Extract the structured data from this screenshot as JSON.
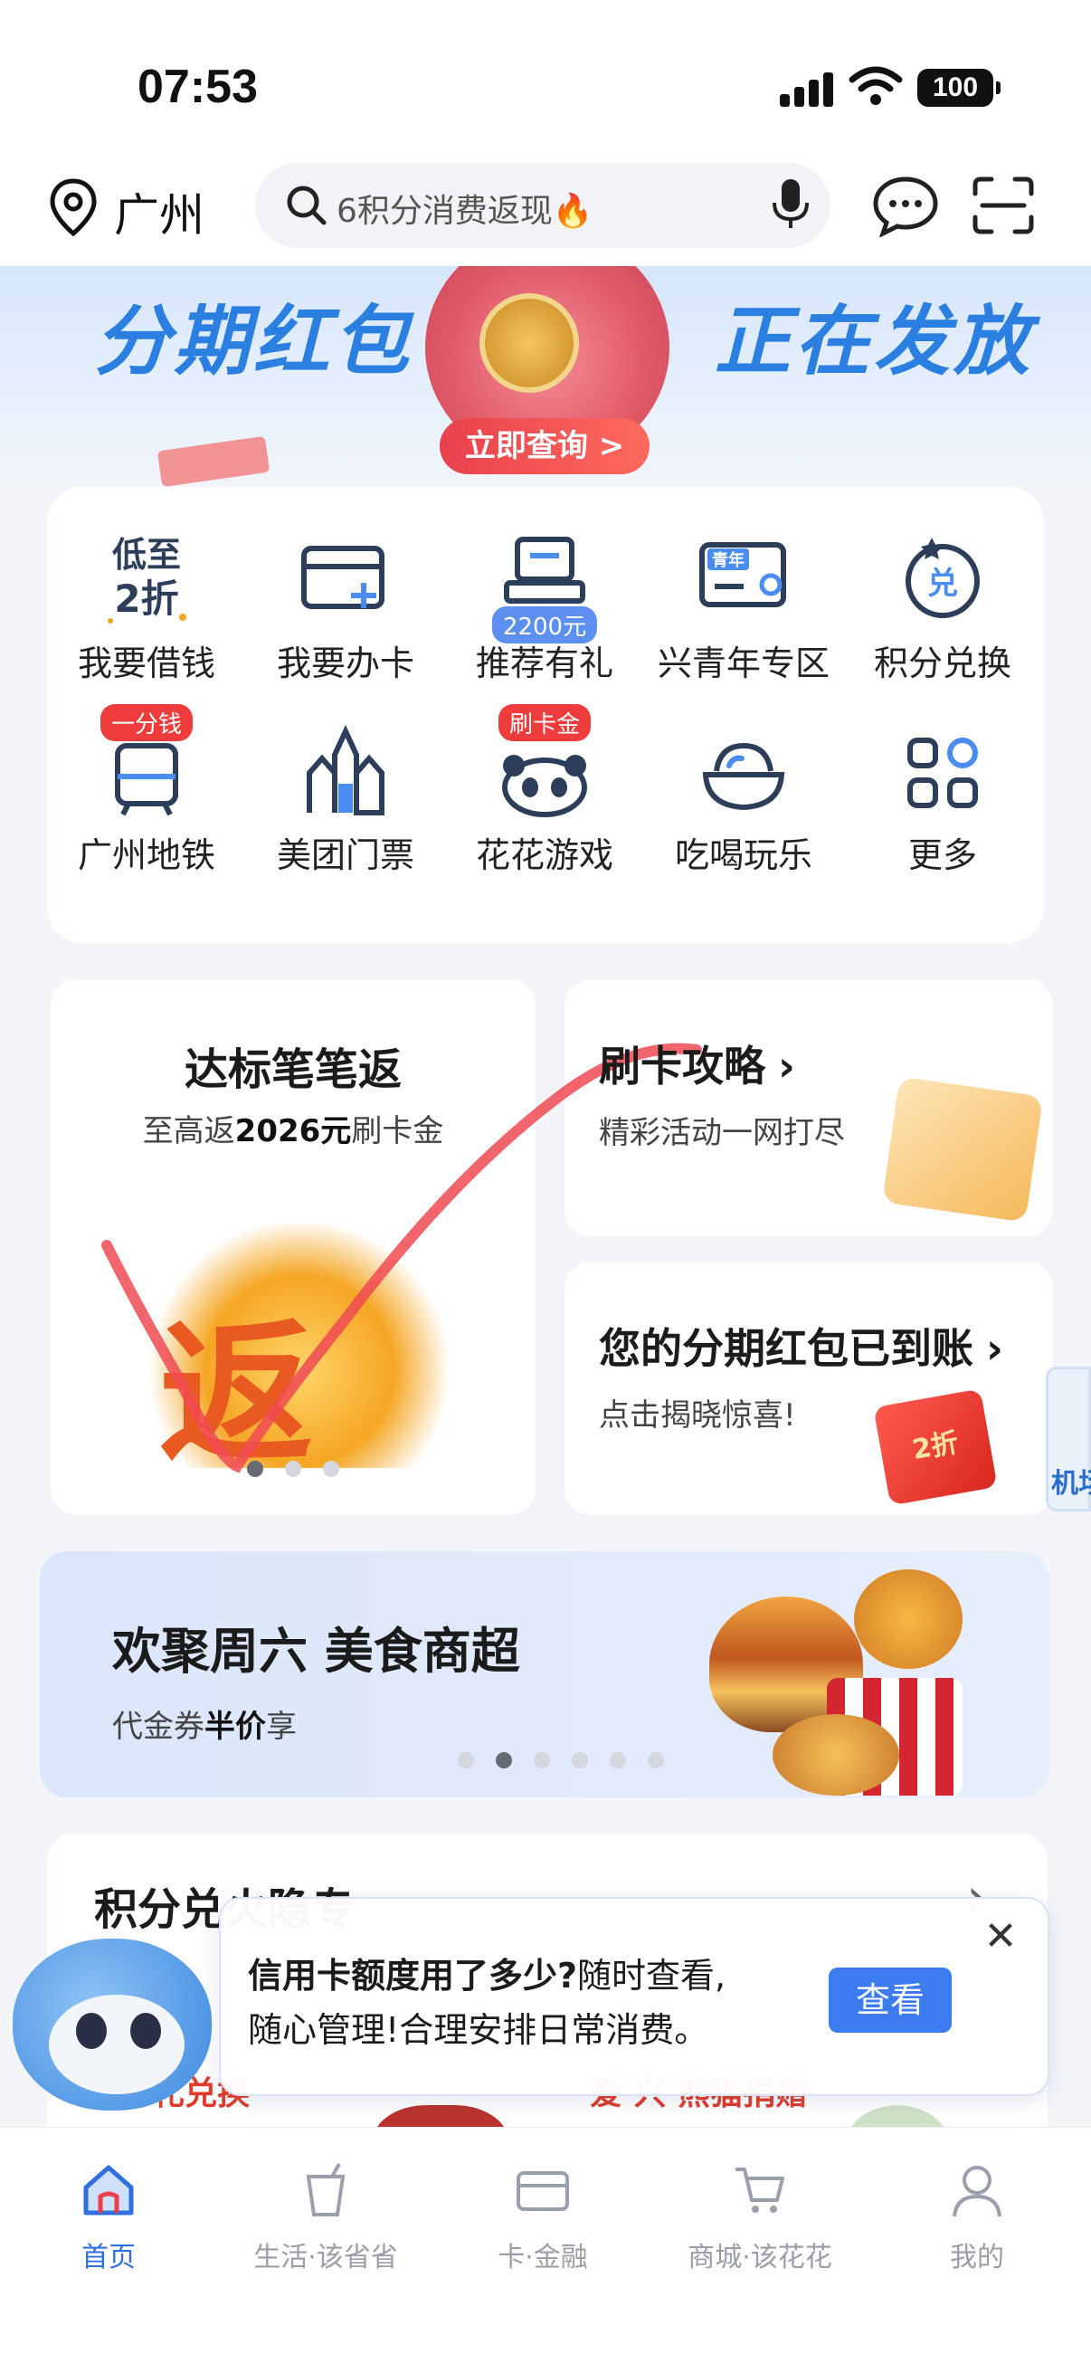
{
  "status_bar": {
    "time": "07:53",
    "battery": "100"
  },
  "header": {
    "city": "广州",
    "search_placeholder": "6积分消费返现🔥"
  },
  "banner": {
    "title_left": "分期红包",
    "title_right": "正在发放",
    "button": "立即查询 >"
  },
  "grid": {
    "items": [
      {
        "label": "我要借钱",
        "icon": "low-to-20-percent-icon",
        "icon_text": "低至\n2折"
      },
      {
        "label": "我要办卡",
        "icon": "card-add-icon"
      },
      {
        "label": "推荐有礼",
        "icon": "recommend-gift-icon",
        "badge": "2200元"
      },
      {
        "label": "兴青年专区",
        "icon": "youth-zone-icon",
        "icon_text": "青年"
      },
      {
        "label": "积分兑换",
        "icon": "points-exchange-icon",
        "icon_text": "兑"
      },
      {
        "label": "广州地铁",
        "icon": "metro-icon",
        "badge": "一分钱"
      },
      {
        "label": "美团门票",
        "icon": "castle-ticket-icon"
      },
      {
        "label": "花花游戏",
        "icon": "panda-game-icon",
        "badge": "刷卡金"
      },
      {
        "label": "吃喝玩乐",
        "icon": "food-bowl-icon"
      },
      {
        "label": "更多",
        "icon": "more-grid-icon"
      }
    ]
  },
  "promo_big": {
    "title": "达标笔笔返",
    "sub_prefix": "至高返",
    "sub_bold": "2026元",
    "sub_suffix": "刷卡金",
    "art_char": "返",
    "dots": 3,
    "active_dot": 0
  },
  "promo_r1": {
    "title": "刷卡攻略",
    "sub": "精彩活动一网打尽"
  },
  "promo_r2": {
    "title": "您的分期红包已到账",
    "sub": "点击揭晓惊喜!",
    "art_text": "2折"
  },
  "edge_widget": {
    "label": "机场"
  },
  "food_banner": {
    "title": "欢聚周六 美食商超",
    "sub_prefix": "代金券",
    "sub_bold": "半价",
    "sub_suffix": "享",
    "dots": 6,
    "active_dot": 1
  },
  "points": {
    "title": "积分兑火隐专",
    "sub1": "行礼兑换",
    "sub2": "爱 兴 熊猫捐赠"
  },
  "popup": {
    "line1_bold": "信用卡额度用了多少?",
    "line1_rest": "随时查看,",
    "line2": "随心管理!合理安排日常消费。",
    "button": "查看",
    "close": "✕"
  },
  "tabs": [
    {
      "label": "首页",
      "icon": "home-icon",
      "active": true
    },
    {
      "label": "生活·该省省",
      "icon": "drink-cup-icon",
      "active": false
    },
    {
      "label": "卡·金融",
      "icon": "card-icon",
      "active": false
    },
    {
      "label": "商城·该花花",
      "icon": "cart-icon",
      "active": false
    },
    {
      "label": "我的",
      "icon": "user-icon",
      "active": false
    }
  ],
  "colors": {
    "accent": "#2f6fe0",
    "banner_title": "#2a7fe0",
    "badge_red": "#ee3b3b",
    "badge_blue": "#5d8ff0",
    "check_stroke": "#f04a52"
  }
}
